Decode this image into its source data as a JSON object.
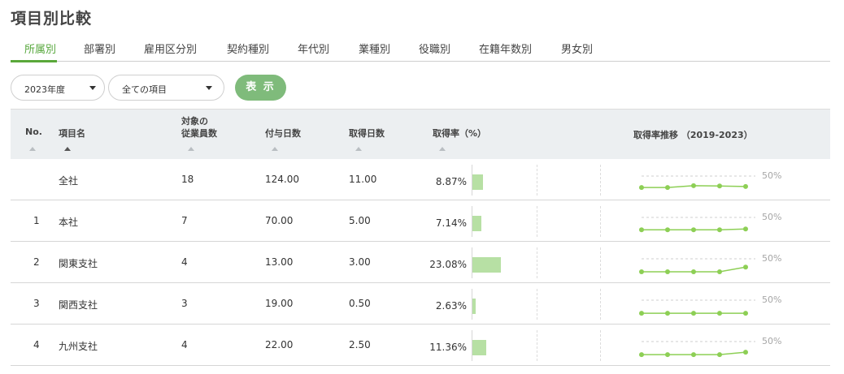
{
  "title": "項目別比較",
  "tabs": [
    "所属別",
    "部署別",
    "雇用区分別",
    "契約種別",
    "年代別",
    "業種別",
    "役職別",
    "在籍年数別",
    "男女別"
  ],
  "active_tab": "所属別",
  "filters": {
    "year": "2023年度",
    "item": "全ての項目",
    "show_label": "表 示"
  },
  "table": {
    "headers": {
      "no": "No.",
      "name": "項目名",
      "employees_line1": "対象の",
      "employees_line2": "従業員数",
      "granted": "付与日数",
      "taken": "取得日数",
      "rate": "取得率（%）",
      "trend": "取得率推移 （2019-2023）"
    },
    "rows": [
      {
        "no": "",
        "name": "全社",
        "employees": "18",
        "granted": "124.00",
        "taken": "11.00",
        "rate_label": "8.87%",
        "rate": 8.87,
        "trend": [
          8.5,
          8.5,
          15.0,
          14.0,
          12.0
        ]
      },
      {
        "no": "1",
        "name": "本社",
        "employees": "7",
        "granted": "70.00",
        "taken": "5.00",
        "rate_label": "7.14%",
        "rate": 7.14,
        "trend": [
          5.0,
          5.0,
          5.0,
          5.0,
          8.0
        ]
      },
      {
        "no": "2",
        "name": "関東支社",
        "employees": "4",
        "granted": "13.00",
        "taken": "3.00",
        "rate_label": "23.08%",
        "rate": 23.08,
        "trend": [
          3.0,
          3.0,
          3.0,
          3.0,
          20.0
        ]
      },
      {
        "no": "3",
        "name": "関西支社",
        "employees": "3",
        "granted": "19.00",
        "taken": "0.50",
        "rate_label": "2.63%",
        "rate": 2.63,
        "trend": [
          2.5,
          2.5,
          2.5,
          2.5,
          2.6
        ]
      },
      {
        "no": "4",
        "name": "九州支社",
        "employees": "4",
        "granted": "22.00",
        "taken": "2.50",
        "rate_label": "11.36%",
        "rate": 11.36,
        "trend": [
          2.5,
          2.5,
          2.5,
          2.5,
          11.36
        ]
      }
    ],
    "trend_reference_label": "50%",
    "trend_reference_value": 50,
    "bar_color": "#b7e0a4",
    "spark_color": "#8dcf55"
  },
  "colors": {
    "accent": "#5aa83a",
    "button": "#7fbb7b"
  }
}
